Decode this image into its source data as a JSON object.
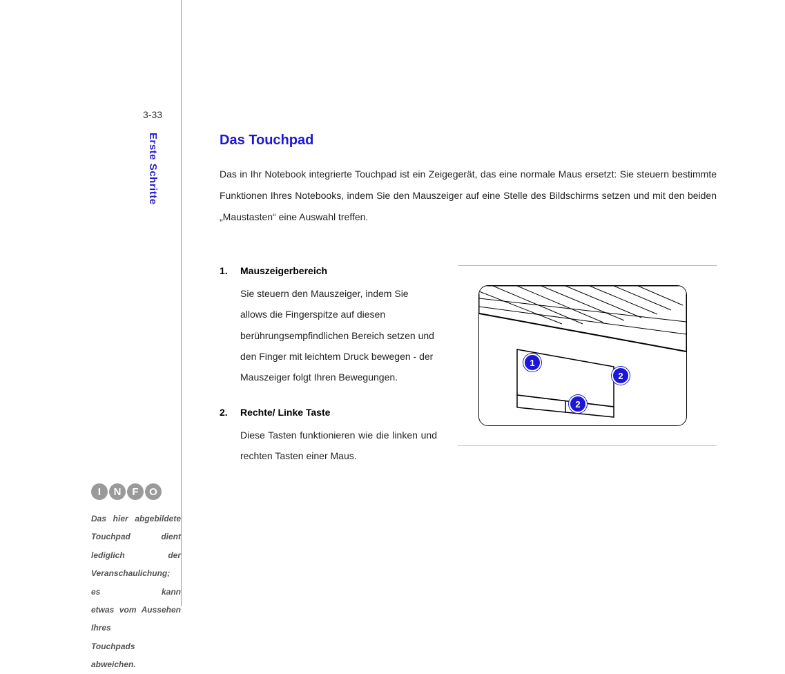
{
  "page_number": "3-33",
  "side_title": "Erste Schritte",
  "heading": "Das Touchpad",
  "intro": "Das in Ihr Notebook integrierte Touchpad ist ein Zeigegerät, das eine normale Maus ersetzt: Sie steuern bestimmte Funktionen Ihres Notebooks, indem Sie den Mauszeiger auf eine Stelle des Bildschirms setzen und mit den beiden „Maustasten“ eine Auswahl treffen.",
  "items": [
    {
      "title": "Mauszeigerbereich",
      "body": "Sie steuern den Mauszeiger, indem Sie allows die Fingerspitze auf diesen berührungsempfindlichen Bereich setzen und den Finger mit leichtem Druck bewegen - der Mauszeiger folgt Ihren Bewegungen."
    },
    {
      "title": "Rechte/ Linke Taste",
      "body": "Diese Tasten funktionieren wie die linken und rechten Tasten einer Maus."
    }
  ],
  "info_icons": [
    "I",
    "N",
    "F",
    "O"
  ],
  "info_text_lines": [
    "Das hier abgebildete",
    "Touchpad dient lediglich der",
    "Veranschaulichung; es kann",
    "etwas vom Aussehen Ihres"
  ],
  "info_text_last": "Touchpads abweichen.",
  "callouts": {
    "c1": "1",
    "c2a": "2",
    "c2b": "2"
  }
}
